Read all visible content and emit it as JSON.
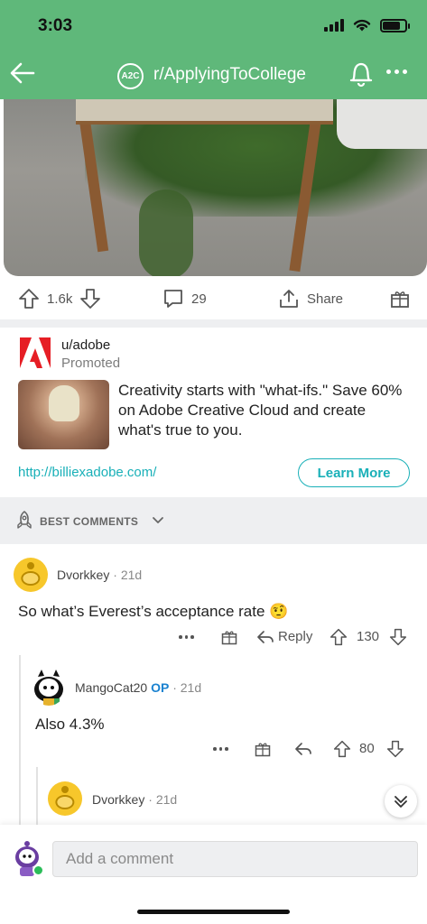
{
  "status": {
    "time": "3:03"
  },
  "header": {
    "subreddit": "r/ApplyingToCollege",
    "sub_logo_text": "A2C",
    "accent": "#5fb87a"
  },
  "post": {
    "upvotes": "1.6k",
    "comments": "29",
    "share_label": "Share"
  },
  "ad": {
    "user": "u/adobe",
    "promoted": "Promoted",
    "text": "Creativity starts with \"what-ifs.\" Save 60% on Adobe Creative Cloud and create what's true to you.",
    "link": "http://billiexadobe.com/",
    "cta": "Learn More",
    "accent": "#19b0b8"
  },
  "sort": {
    "label": "BEST COMMENTS"
  },
  "comments": [
    {
      "user": "Dvorkkey",
      "age": "21d",
      "body": "So what’s Everest’s acceptance rate 🤨",
      "reply_label": "Reply",
      "score": "130"
    },
    {
      "user": "MangoCat20",
      "op_label": "OP",
      "age": "21d",
      "body": "Also 4.3%",
      "score": "80"
    },
    {
      "user": "Dvorkkey",
      "age": "21d"
    }
  ],
  "composer": {
    "placeholder": "Add a comment"
  },
  "icons": [
    "back-arrow-icon",
    "bell-icon",
    "more-icon",
    "upvote-icon",
    "downvote-icon",
    "comment-icon",
    "share-icon",
    "award-icon",
    "rocket-icon",
    "chevron-down-icon",
    "reply-icon",
    "collapse-icon"
  ]
}
